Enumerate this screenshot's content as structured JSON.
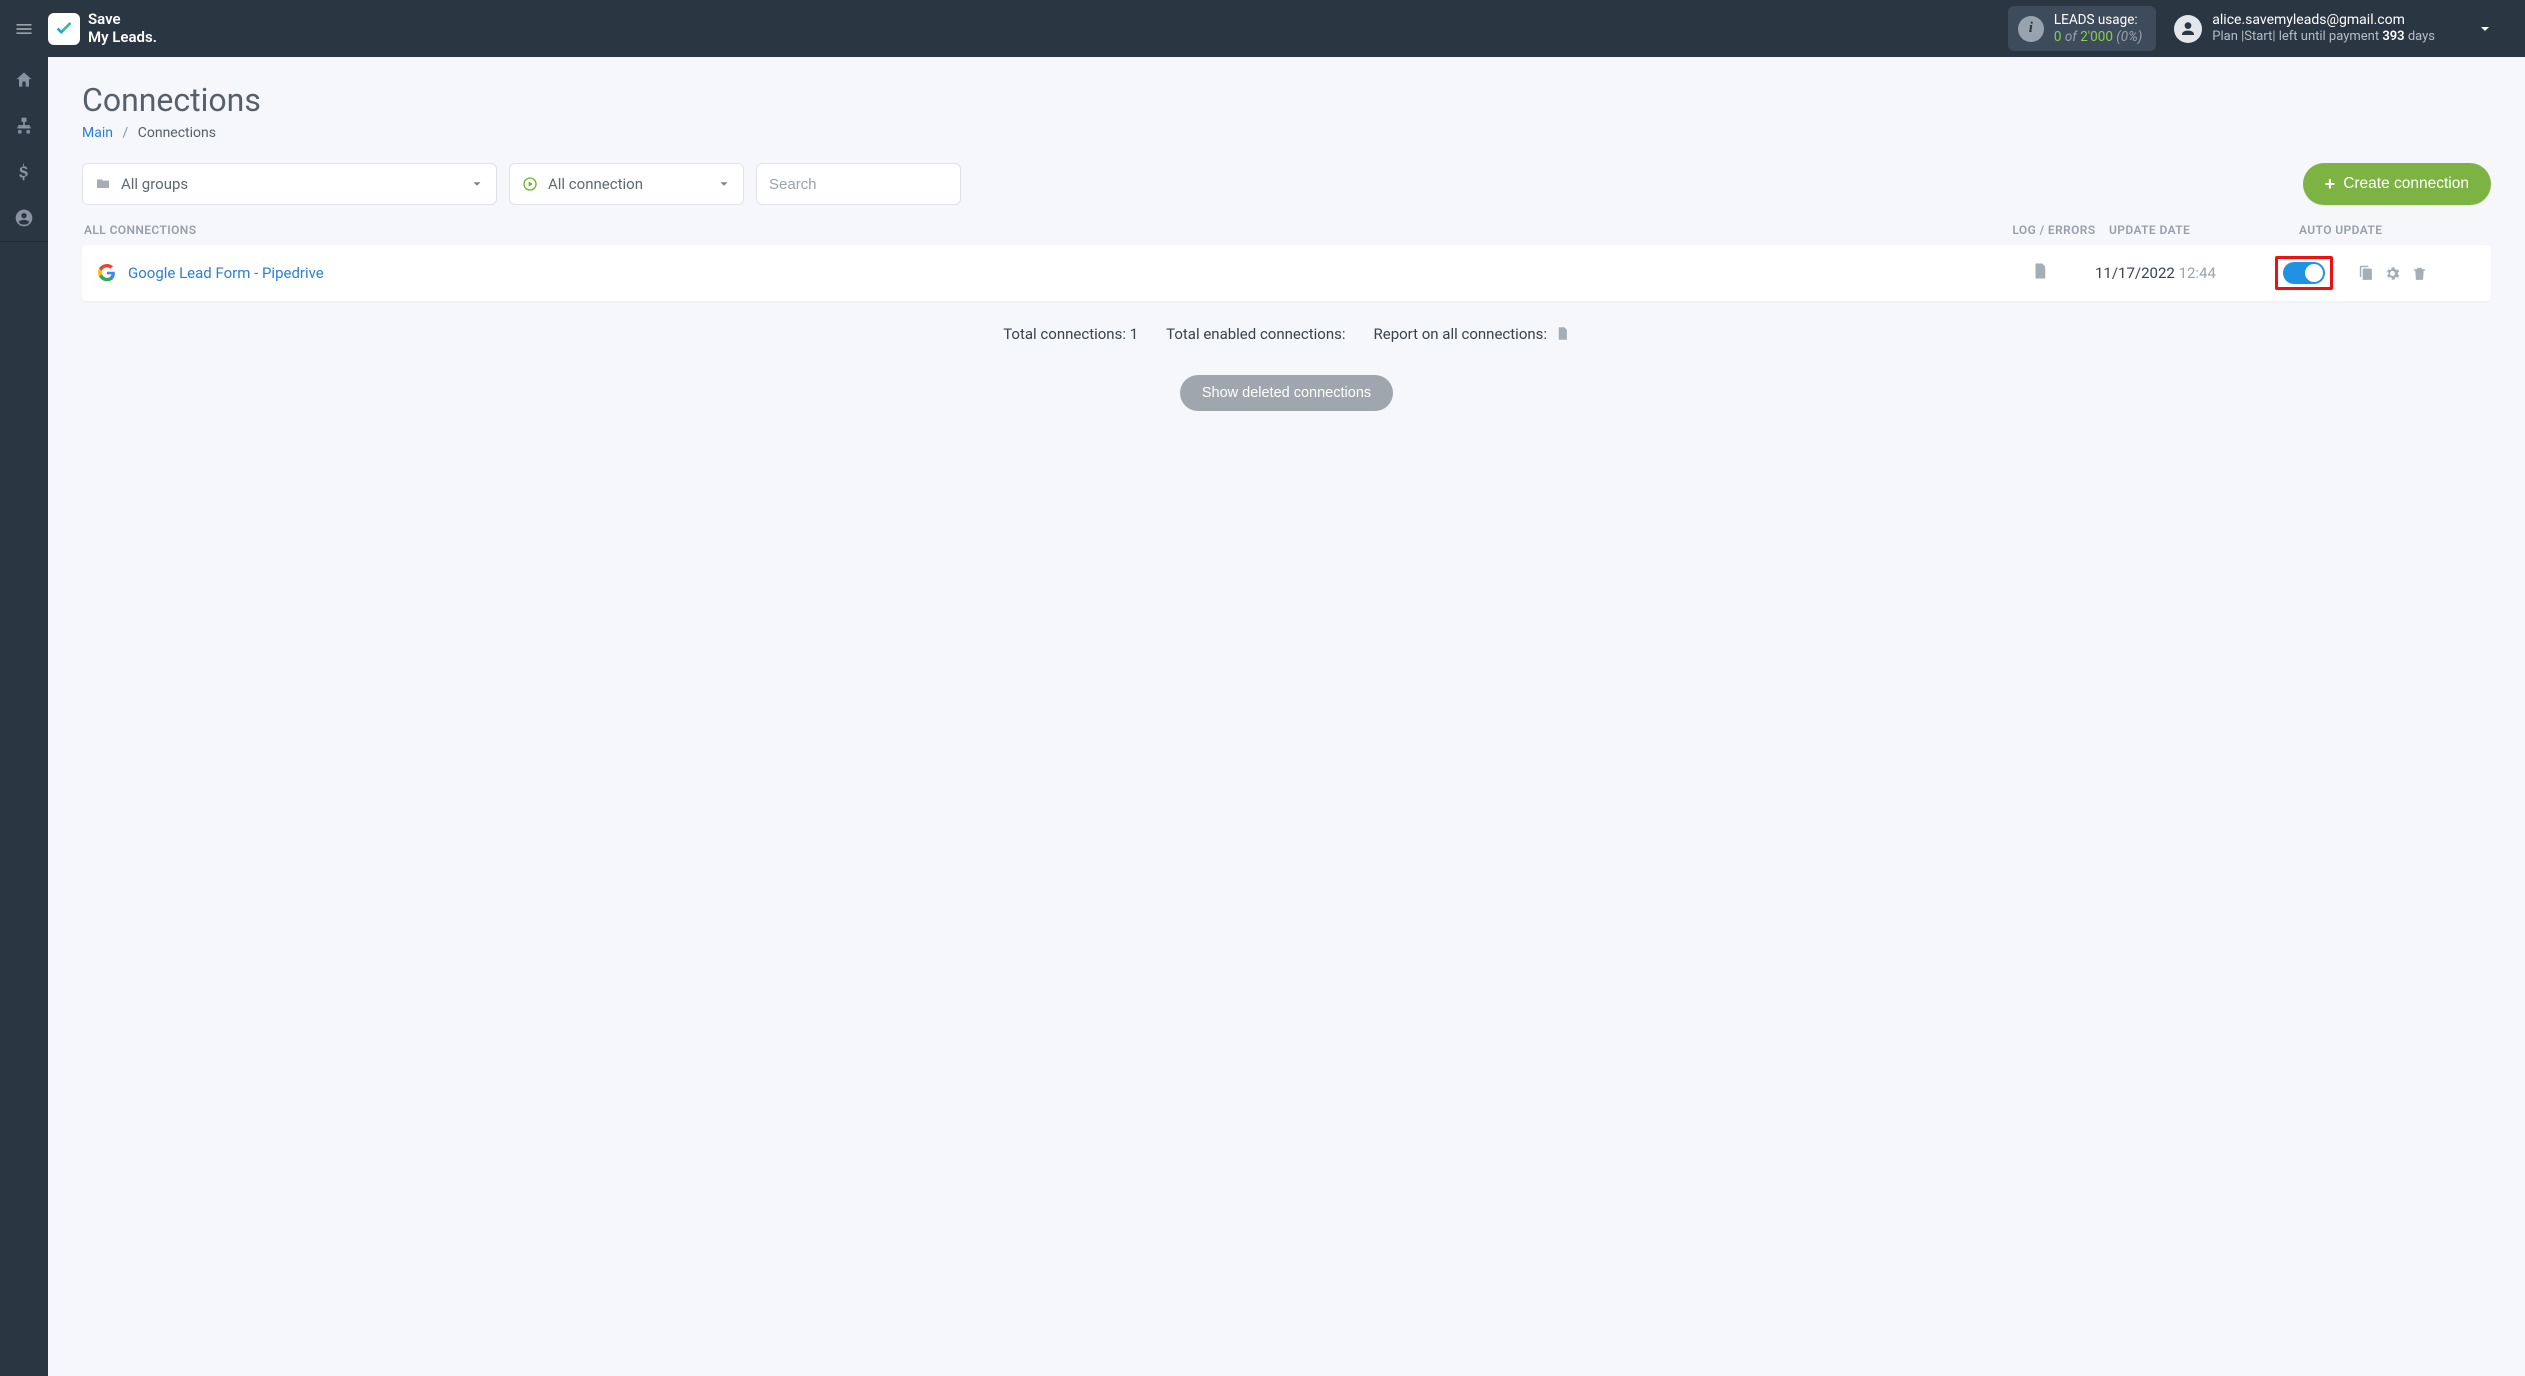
{
  "brand": {
    "line1": "Save",
    "line2": "My Leads."
  },
  "usage": {
    "label": "LEADS usage:",
    "used": "0",
    "of_word": "of",
    "total": "2'000",
    "pct": "(0%)"
  },
  "account": {
    "email": "alice.savemyleads@gmail.com",
    "plan_pre": "Plan |",
    "plan_name": "Start",
    "plan_mid": "| left until payment ",
    "days": "393",
    "days_word": " days"
  },
  "page": {
    "title": "Connections",
    "breadcrumb_home": "Main",
    "breadcrumb_current": "Connections"
  },
  "filters": {
    "groups": "All groups",
    "status": "All connection",
    "search_placeholder": "Search"
  },
  "buttons": {
    "create": "Create connection",
    "show_deleted": "Show deleted connections"
  },
  "table": {
    "head_name": "All connections",
    "head_log": "Log / Errors",
    "head_date": "Update date",
    "head_auto": "Auto update"
  },
  "rows": [
    {
      "name": "Google Lead Form - Pipedrive",
      "date": "11/17/2022",
      "time": "12:44",
      "auto_on": true
    }
  ],
  "stats": {
    "total_conn_label": "Total connections: ",
    "total_conn_val": "1",
    "total_enabled_label": "Total enabled connections:",
    "report_label": "Report on all connections:"
  }
}
